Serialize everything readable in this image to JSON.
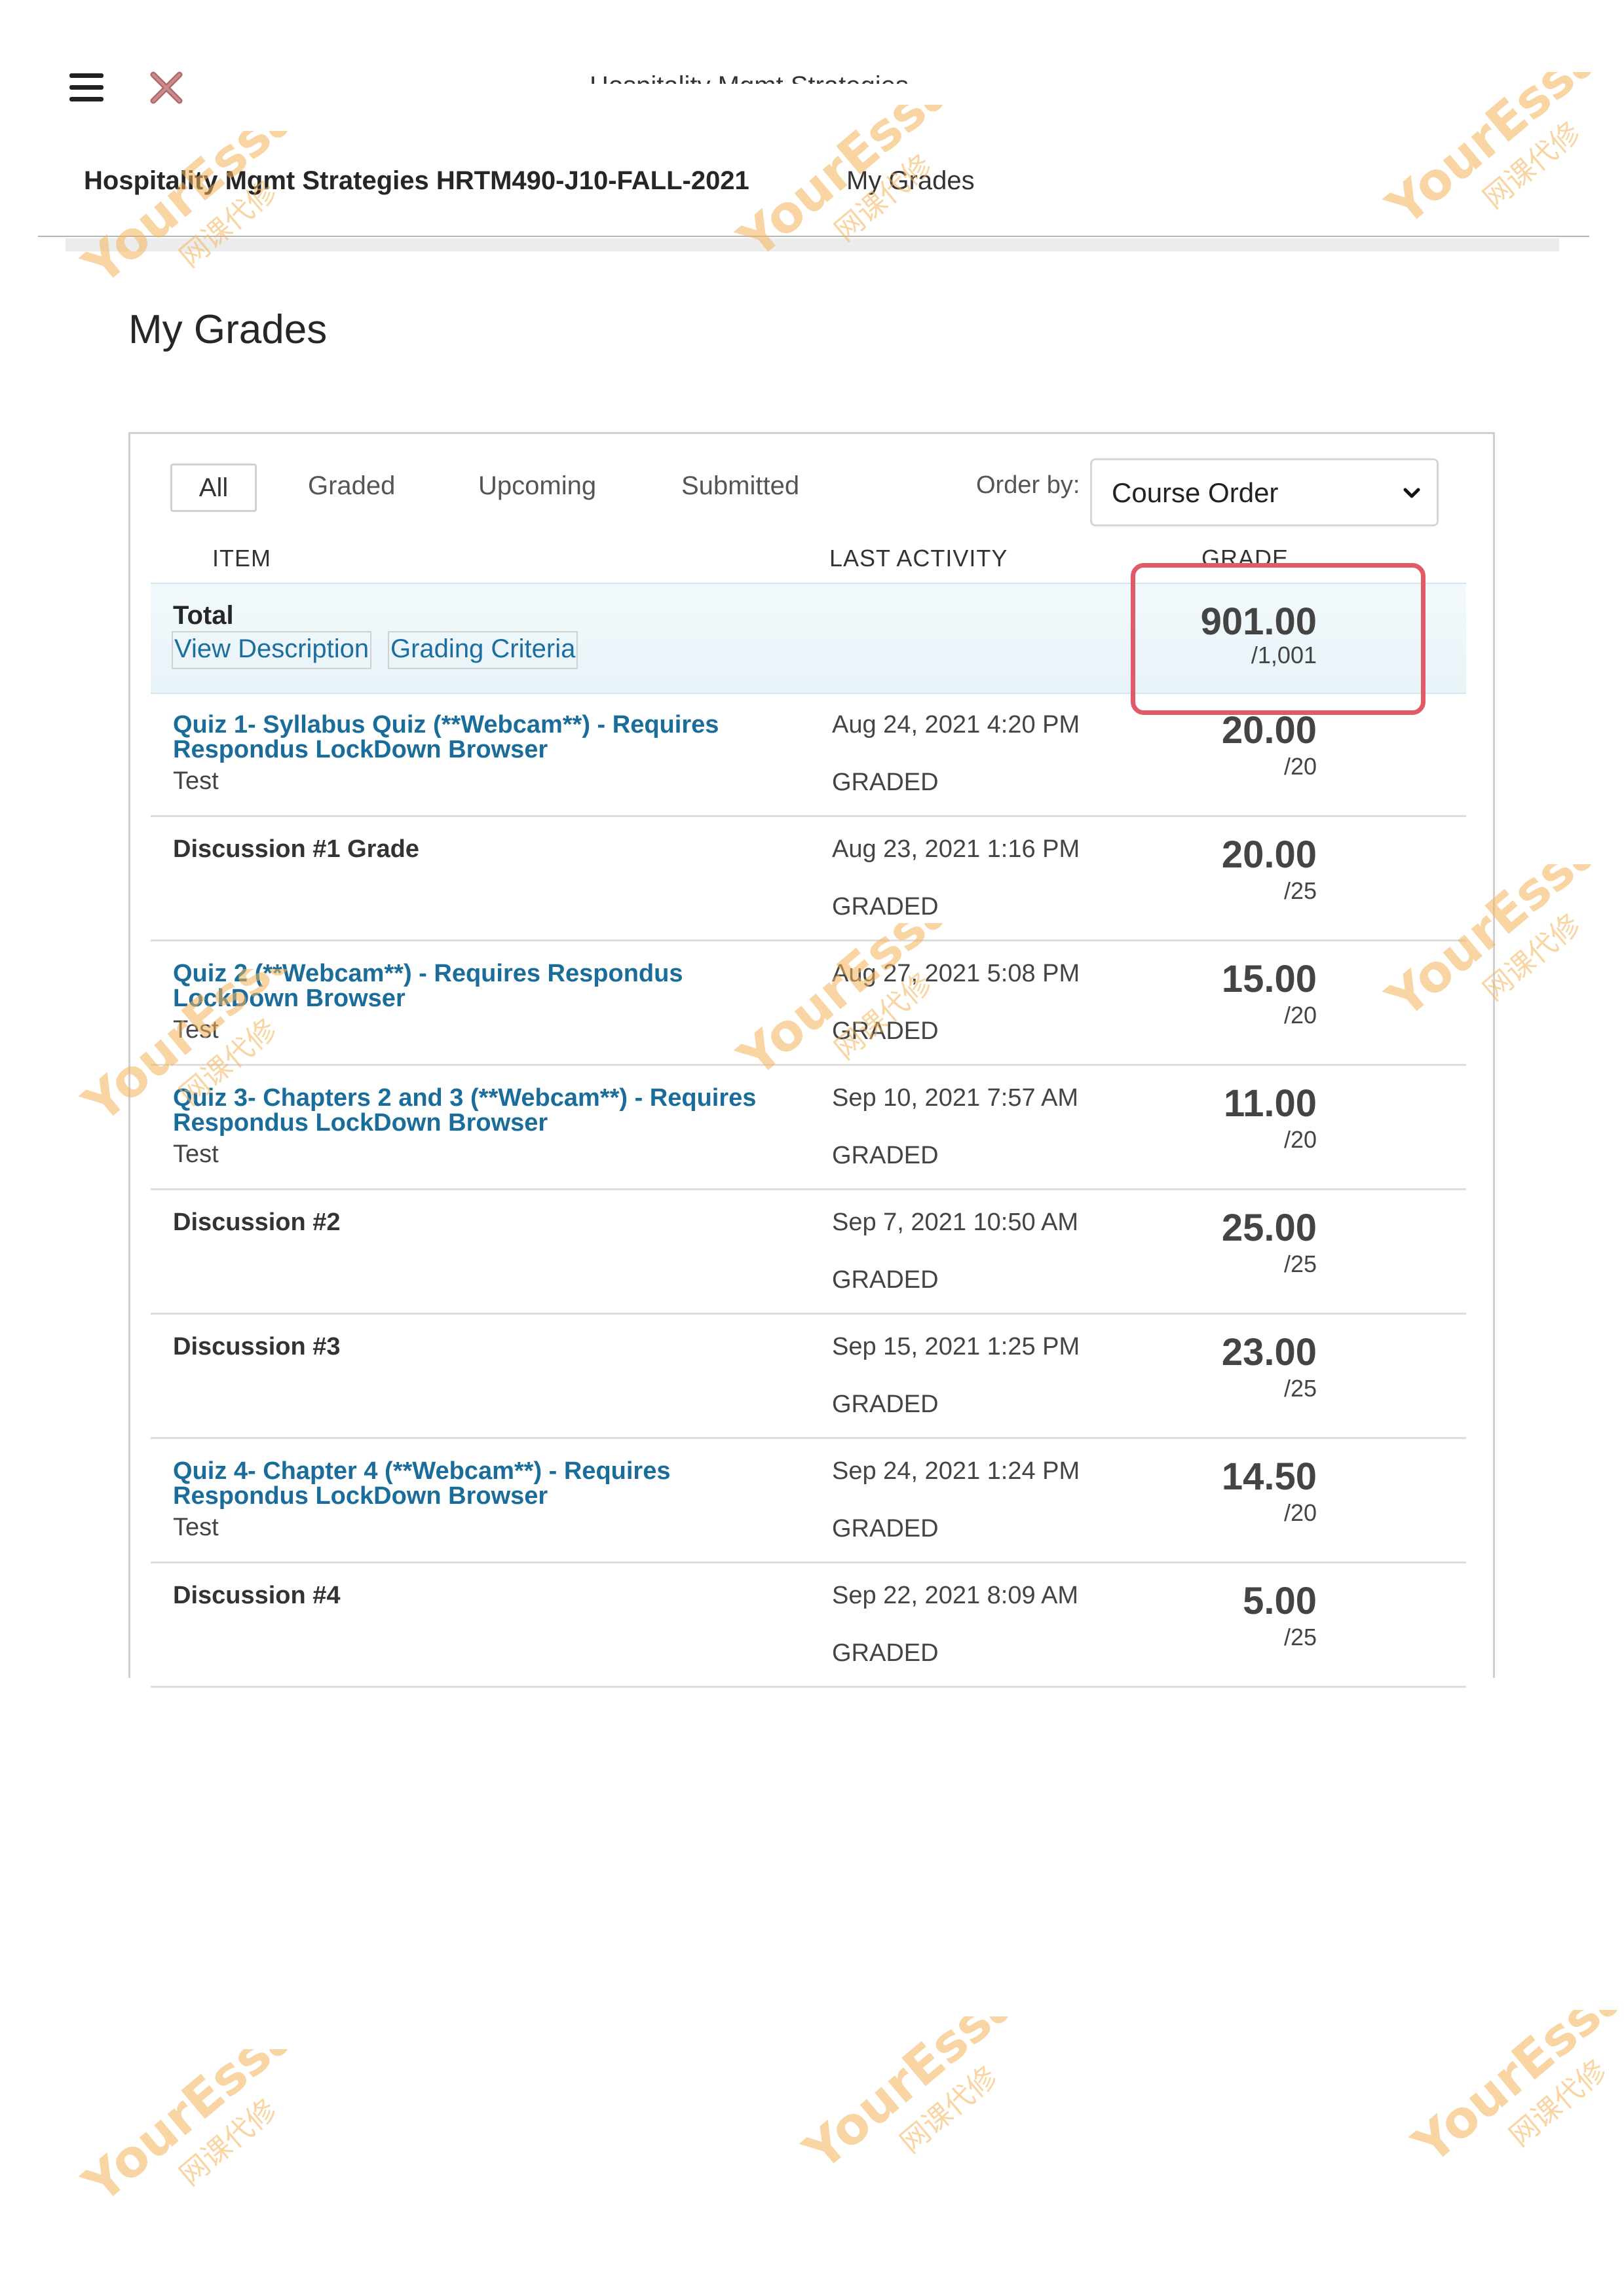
{
  "header": {
    "partial_title": "Hospitality Mgmt Strategies",
    "course": "Hospitality Mgmt Strategies HRTM490-J10-FALL-2021",
    "current": "My Grades"
  },
  "page_title": "My Grades",
  "filters": {
    "all": "All",
    "graded": "Graded",
    "upcoming": "Upcoming",
    "submitted": "Submitted"
  },
  "order": {
    "label": "Order by:",
    "value": "Course Order"
  },
  "columns": {
    "item": "ITEM",
    "activity": "LAST ACTIVITY",
    "grade": "GRADE"
  },
  "total": {
    "label": "Total",
    "view_description": "View Description",
    "grading_criteria": "Grading Criteria",
    "score": "901.00",
    "max": "/1,001"
  },
  "items": [
    {
      "title": "Quiz 1- Syllabus Quiz (**Webcam**) - Requires Respondus LockDown Browser",
      "type": "Test",
      "date": "Aug 24, 2021 4:20 PM",
      "status": "GRADED",
      "score": "20.00",
      "max": "/20"
    },
    {
      "title": "Discussion #1 Grade",
      "type": "",
      "date": "Aug 23, 2021 1:16 PM",
      "status": "GRADED",
      "score": "20.00",
      "max": "/25"
    },
    {
      "title": "Quiz 2 (**Webcam**) - Requires Respondus LockDown Browser",
      "type": "Test",
      "date": "Aug 27, 2021 5:08 PM",
      "status": "GRADED",
      "score": "15.00",
      "max": "/20"
    },
    {
      "title": "Quiz 3- Chapters 2 and 3 (**Webcam**) - Requires Respondus LockDown Browser",
      "type": "Test",
      "date": "Sep 10, 2021 7:57 AM",
      "status": "GRADED",
      "score": "11.00",
      "max": "/20"
    },
    {
      "title": "Discussion #2",
      "type": "",
      "date": "Sep 7, 2021 10:50 AM",
      "status": "GRADED",
      "score": "25.00",
      "max": "/25"
    },
    {
      "title": "Discussion #3",
      "type": "",
      "date": "Sep 15, 2021 1:25 PM",
      "status": "GRADED",
      "score": "23.00",
      "max": "/25"
    },
    {
      "title": "Quiz 4- Chapter 4 (**Webcam**) - Requires Respondus LockDown Browser",
      "type": "Test",
      "date": "Sep 24, 2021 1:24 PM",
      "status": "GRADED",
      "score": "14.50",
      "max": "/20"
    },
    {
      "title": "Discussion #4",
      "type": "",
      "date": "Sep 22, 2021 8:09 AM",
      "status": "GRADED",
      "score": "5.00",
      "max": "/25"
    }
  ],
  "watermark": {
    "brand": "YourEssay",
    "sub": "网课代修"
  },
  "colors": {
    "link": "#1a6d9b",
    "highlight": "#e05a67",
    "watermark": "#f5b45a"
  }
}
